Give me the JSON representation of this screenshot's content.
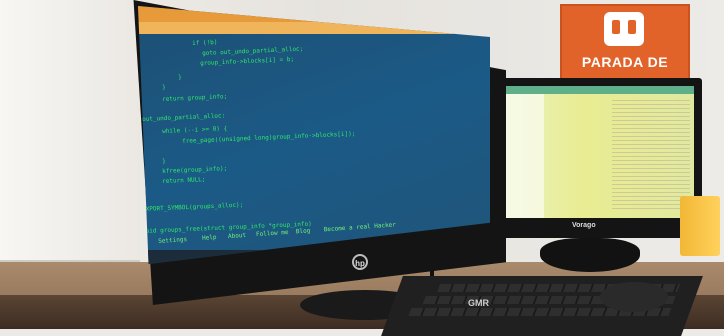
{
  "scene": {
    "sign_text": "PARADA DE",
    "left_monitor_brand": "hp",
    "right_monitor_brand": "Vorago",
    "keyboard_brand": "GMR",
    "colors": {
      "code_text": "#2fe86a",
      "editor_bg": "#1b5a86",
      "browser_bar": "#e79a3a",
      "sign_orange": "#e2632a"
    }
  },
  "code_lines": [
    "if (!b)",
    "goto out_undo_partial_alloc;",
    "group_info->blocks[i] = b;",
    "}",
    "}",
    "return group_info;",
    "out_undo_partial_alloc:",
    "while (--i >= 0) {",
    "free_page((unsigned long)group_info->blocks[i]);",
    "}",
    "kfree(group_info);",
    "return NULL;",
    "}",
    "EXPORT_SYMBOL(groups_alloc);",
    "void groups_free(struct group_info *group_info)"
  ],
  "editor_menu": [
    "Settings",
    "Help",
    "About",
    "Follow me",
    "Blog",
    "Become a real Hacker"
  ]
}
